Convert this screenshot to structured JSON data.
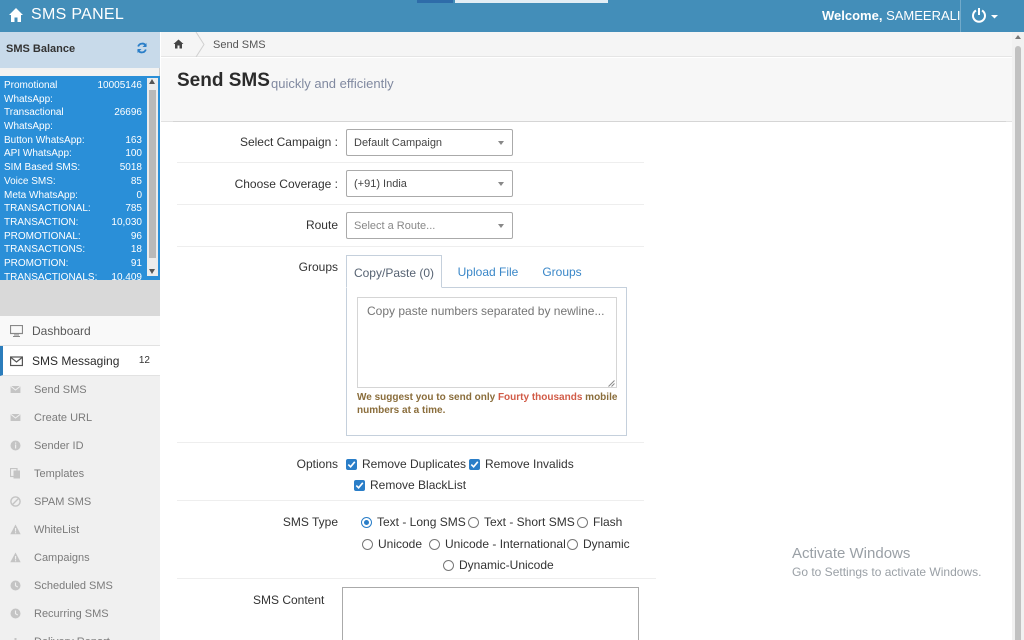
{
  "navbar": {
    "brand": "SMS PANEL",
    "welcome_prefix": "Welcome,",
    "username": "SAMEERALI"
  },
  "sidebar": {
    "balance_title": "SMS Balance",
    "balances": [
      {
        "label": "Promotional",
        "value": "10005146"
      },
      {
        "label": "WhatsApp:",
        "value": ""
      },
      {
        "label": "Transactional",
        "value": "26696"
      },
      {
        "label": "WhatsApp:",
        "value": ""
      },
      {
        "label": "Button WhatsApp:",
        "value": "163"
      },
      {
        "label": "API WhatsApp:",
        "value": "100"
      },
      {
        "label": "SIM Based SMS:",
        "value": "5018"
      },
      {
        "label": "Voice SMS:",
        "value": "85"
      },
      {
        "label": "Meta WhatsApp:",
        "value": "0"
      },
      {
        "label": "TRANSACTIONAL:",
        "value": "785"
      },
      {
        "label": "TRANSACTION:",
        "value": "10,030"
      },
      {
        "label": "PROMOTIONAL:",
        "value": "96"
      },
      {
        "label": "TRANSACTIONS:",
        "value": "18"
      },
      {
        "label": "PROMOTION:",
        "value": "91"
      },
      {
        "label": "TRANSACTIONALS:",
        "value": "10,409"
      }
    ],
    "menu": {
      "dashboard": "Dashboard",
      "sms_messaging": "SMS Messaging",
      "sms_messaging_badge": "12",
      "submenu": [
        {
          "label": "Send SMS",
          "icon": "envelope-icon"
        },
        {
          "label": "Create URL",
          "icon": "envelope-icon"
        },
        {
          "label": "Sender ID",
          "icon": "info-icon"
        },
        {
          "label": "Templates",
          "icon": "copy-icon"
        },
        {
          "label": "SPAM SMS",
          "icon": "ban-icon"
        },
        {
          "label": "WhiteList",
          "icon": "warning-icon"
        },
        {
          "label": "Campaigns",
          "icon": "warning-icon"
        },
        {
          "label": "Scheduled SMS",
          "icon": "clock-icon"
        },
        {
          "label": "Recurring SMS",
          "icon": "clock-icon"
        },
        {
          "label": "Delivery Report",
          "icon": "chart-icon"
        }
      ]
    }
  },
  "breadcrumb": {
    "current": "Send SMS"
  },
  "header": {
    "title": "Send SMS",
    "subtitle": "quickly and efficiently"
  },
  "form": {
    "campaign_label": "Select Campaign :",
    "campaign_value": "Default Campaign",
    "coverage_label": "Choose Coverage :",
    "coverage_value": "(+91) India",
    "route_label": "Route",
    "route_placeholder": "Select a Route...",
    "groups_label": "Groups",
    "tabs": [
      "Copy/Paste (0)",
      "Upload File",
      "Groups"
    ],
    "numbers_placeholder": "Copy paste numbers separated by newline...",
    "suggest_pre": "We suggest you to send only ",
    "suggest_highlight": "Fourty thousands",
    "suggest_post": " mobile numbers at a time.",
    "options_label": "Options",
    "options": [
      "Remove Duplicates",
      "Remove Invalids",
      "Remove BlackList"
    ],
    "sms_type_label": "SMS Type",
    "sms_types": [
      "Text - Long SMS",
      "Text - Short SMS",
      "Flash",
      "Unicode",
      "Unicode - International",
      "Dynamic",
      "Dynamic-Unicode"
    ],
    "sms_type_selected": "Text - Long SMS",
    "content_label": "SMS Content"
  },
  "watermark": {
    "line1": "Activate Windows",
    "line2": "Go to Settings to activate Windows."
  },
  "colors": {
    "navbar": "#438eb9",
    "balance_box": "#2a8fd8",
    "accent": "#2a7ec8",
    "highlight": "#d15b47"
  }
}
